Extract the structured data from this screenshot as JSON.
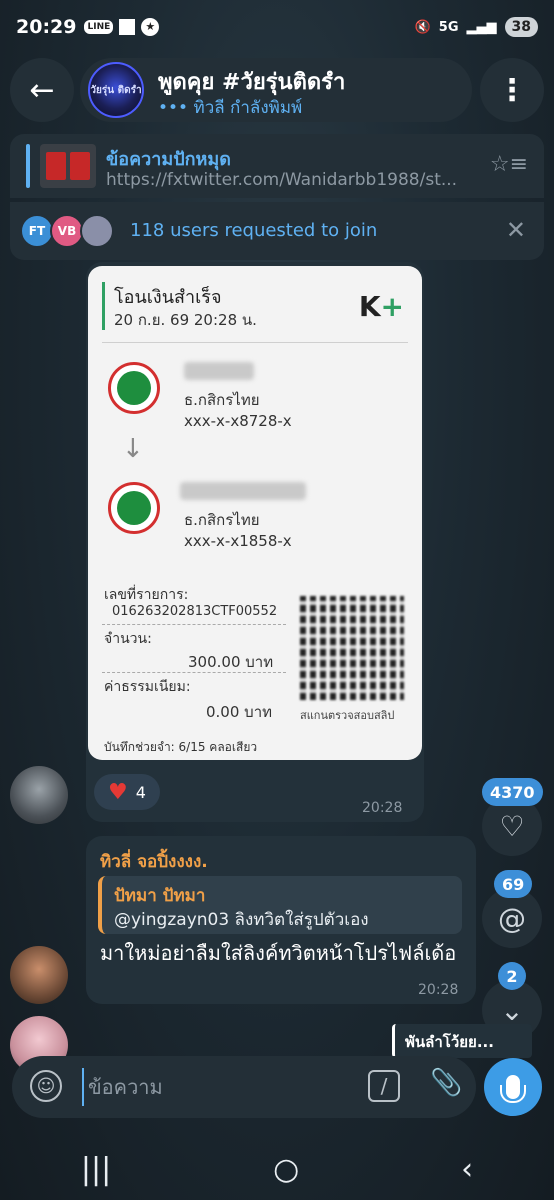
{
  "status_bar": {
    "time": "20:29",
    "line_label": "LINE",
    "network": "5G",
    "battery": "38"
  },
  "header": {
    "back_icon": "arrow-left-icon",
    "avatar_text": "วัยรุ่น ติดรำ",
    "title": "พูดคุย #วัยรุ่นติดรำ",
    "typing_status": "••• ทิวลี กำลังพิมพ์"
  },
  "pinned": {
    "title": "ข้อความปักหมุด",
    "url": "https://fxtwitter.com/Wanidarbb1988/st..."
  },
  "join_requests": {
    "avatars": [
      "FT",
      "VB",
      ""
    ],
    "text": "118 users requested to join"
  },
  "slip": {
    "title": "โอนเงินสำเร็จ",
    "date": "20 ก.ย. 69  20:28 น.",
    "logo": "K+",
    "from": {
      "bank": "ธ.กสิกรไทย",
      "account": "xxx-x-x8728-x"
    },
    "to": {
      "bank": "ธ.กสิกรไทย",
      "account": "xxx-x-x1858-x"
    },
    "ref_label": "เลขที่รายการ:",
    "ref_value": "016263202813CTF00552",
    "amount_label": "จำนวน:",
    "amount_value": "300.00 บาท",
    "fee_label": "ค่าธรรมเนียม:",
    "fee_value": "0.00 บาท",
    "qr_caption": "สแกนตรวจสอบสลิป",
    "memo": "บันทึกช่วยจำ: 6/15 คลอเสียว"
  },
  "slip_message": {
    "reaction_count": "4",
    "time": "20:28"
  },
  "text_message": {
    "author": "ทิวลี่ จอปิ้งงงง.",
    "reply_name": "ปัทมา ปัทมา",
    "reply_text": "@yingzayn03 ลิงทวิตใส่รูปตัวเอง",
    "body": "มาใหม่อย่าลืมใส่ลิงค์ทวิตหน้าโปรไฟล์เด้อ",
    "time": "20:28"
  },
  "side_buttons": {
    "reactions_count": "4370",
    "mentions_count": "69",
    "unread_count": "2"
  },
  "preview": {
    "text": "พันลำโว้ยย..."
  },
  "composer": {
    "placeholder": "ข้อความ"
  }
}
